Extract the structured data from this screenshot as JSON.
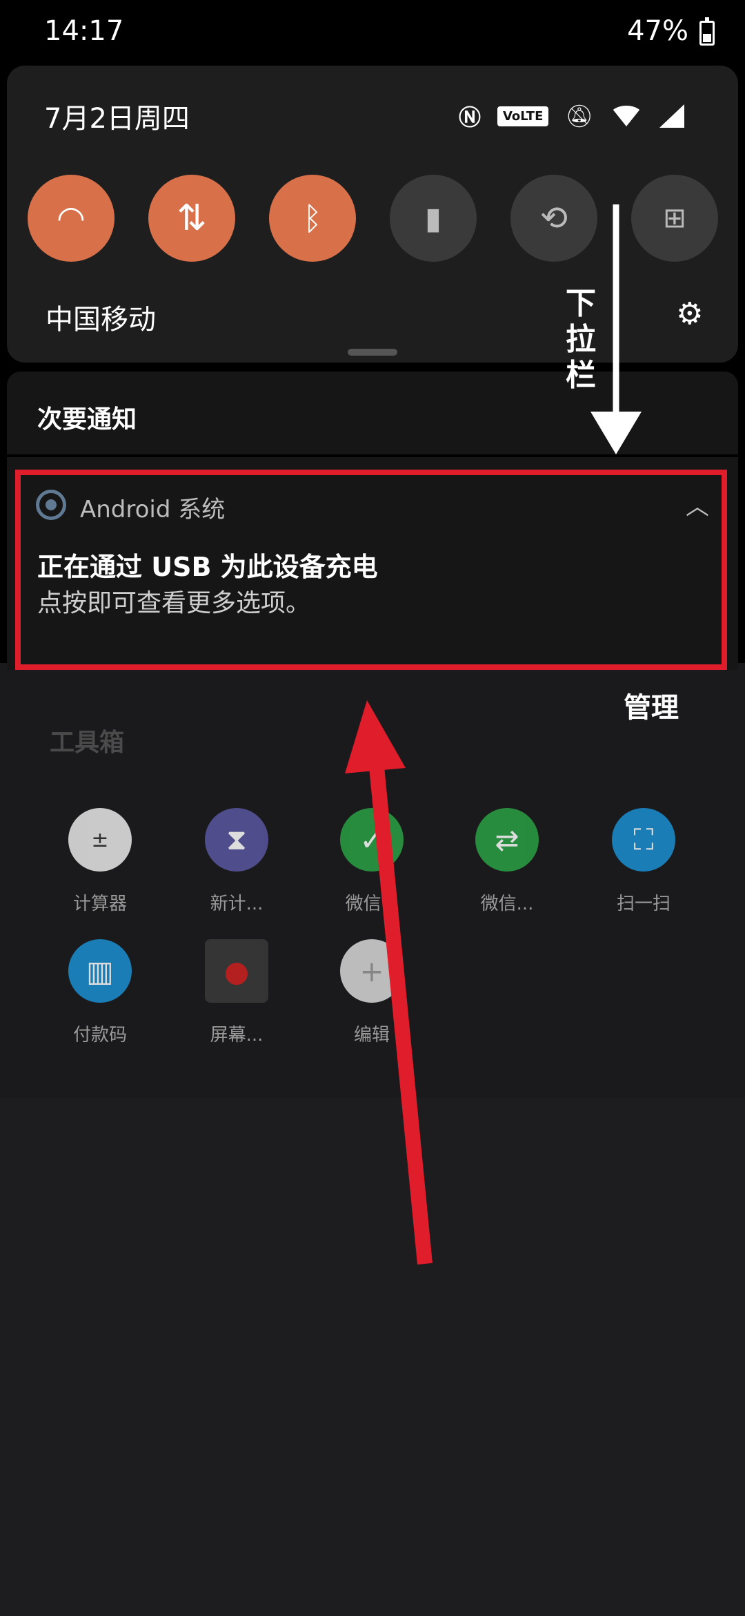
{
  "status_bar": {
    "time": "14:17",
    "battery": "47%"
  },
  "quick_settings": {
    "date": "7月2日周四",
    "volte": "VoLTE",
    "carrier": "中国移动",
    "tiles": [
      {
        "name": "wifi",
        "state": "on"
      },
      {
        "name": "mobile-data",
        "state": "on"
      },
      {
        "name": "bluetooth",
        "state": "on"
      },
      {
        "name": "flashlight",
        "state": "off"
      },
      {
        "name": "auto-rotate",
        "state": "off"
      },
      {
        "name": "battery-saver",
        "state": "off"
      }
    ]
  },
  "notifications": {
    "section_label": "次要通知",
    "card": {
      "app_name": "Android 系统",
      "title": "正在通过 USB 为此设备充电",
      "body": "点按即可查看更多选项。"
    }
  },
  "background_app": {
    "manage_label": "管理",
    "toolbox_title": "工具箱",
    "tools": [
      {
        "label": "计算器",
        "icon": "calculator-icon",
        "color": "#e9e9e9"
      },
      {
        "label": "新计...",
        "icon": "hourglass-icon",
        "color": "#5a56a0"
      },
      {
        "label": "微信...",
        "icon": "wechat-scan-icon",
        "color": "#2aa043"
      },
      {
        "label": "微信...",
        "icon": "wechat-transfer-icon",
        "color": "#2aa043"
      },
      {
        "label": "扫一扫",
        "icon": "scan-icon",
        "color": "#1a8fd0"
      },
      {
        "label": "付款码",
        "icon": "barcode-icon",
        "color": "#1a8fd0"
      },
      {
        "label": "屏幕...",
        "icon": "screen-record-icon",
        "color": "#3a3a3a"
      },
      {
        "label": "编辑",
        "icon": "add-icon",
        "color": "#d9d9d9"
      }
    ]
  },
  "annotations": {
    "down_label": "下拉栏",
    "highlight_color": "#e01d2b"
  }
}
